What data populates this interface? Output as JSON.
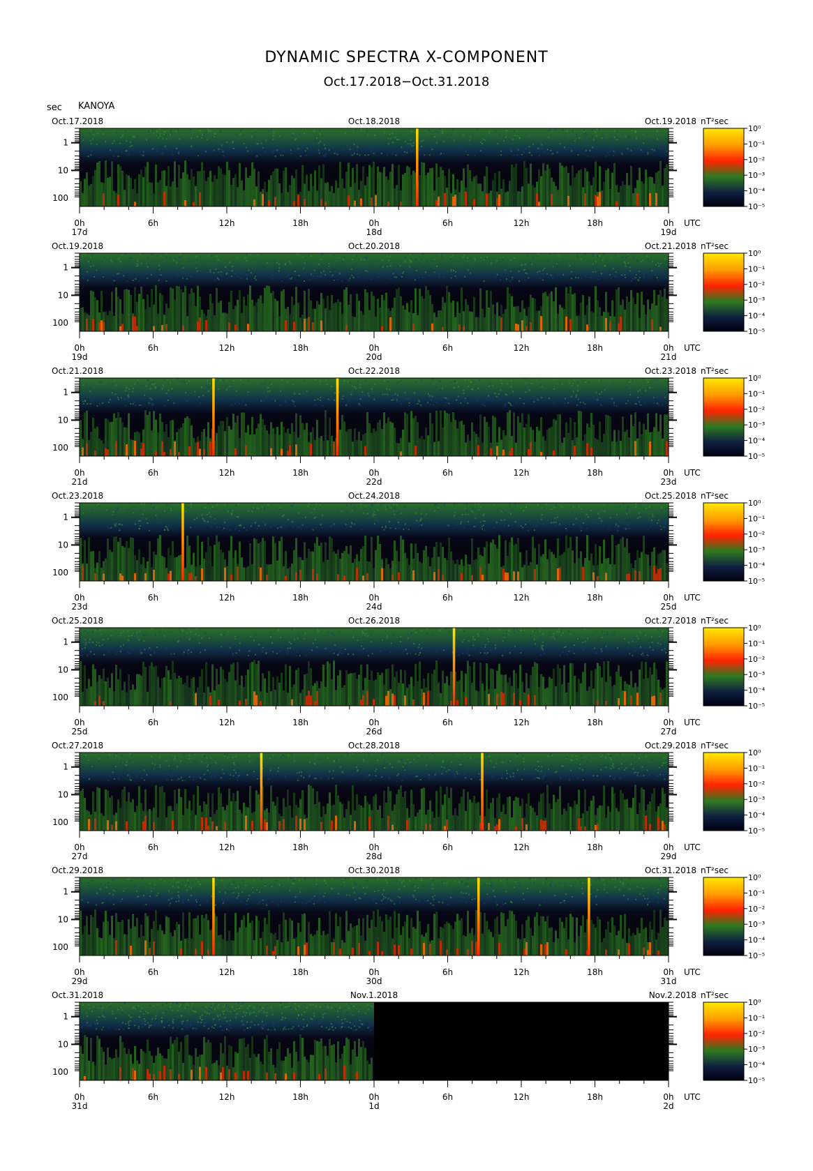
{
  "title": "DYNAMIC SPECTRA X-COMPONENT",
  "subtitle": "Oct.17.2018−Oct.31.2018",
  "axis_unit_label": "sec",
  "station": "KANOYA",
  "colorbar_unit": "nT²sec",
  "utc_label": "UTC",
  "y_tick_labels": [
    "1",
    "10",
    "100"
  ],
  "x_hour_labels": [
    "0h",
    "6h",
    "12h",
    "18h",
    "0h",
    "6h",
    "12h",
    "18h",
    "0h"
  ],
  "colorbar_ticks": [
    "10⁰",
    "10⁻¹",
    "10⁻²",
    "10⁻³",
    "10⁻⁴",
    "10⁻⁵"
  ],
  "colors": {
    "noise_low": "#0a0a28",
    "noise_band": "#2a6a28",
    "high_power": "#ff2a00",
    "peak": "#ffd800",
    "no_data": "#000000"
  },
  "panels": [
    {
      "date_left": "Oct.17.2018",
      "date_mid": "Oct.18.2018",
      "date_right": "Oct.19.2018",
      "day_left": "17d",
      "day_mid": "18d",
      "day_right": "19d",
      "spike_hours": [
        27.5
      ],
      "data_end_hours": 48
    },
    {
      "date_left": "Oct.19.2018",
      "date_mid": "Oct.20.2018",
      "date_right": "Oct.21.2018",
      "day_left": "19d",
      "day_mid": "20d",
      "day_right": "21d",
      "spike_hours": [],
      "data_end_hours": 48
    },
    {
      "date_left": "Oct.21.2018",
      "date_mid": "Oct.22.2018",
      "date_right": "Oct.23.2018",
      "day_left": "21d",
      "day_mid": "22d",
      "day_right": "23d",
      "spike_hours": [
        10.9,
        21
      ],
      "data_end_hours": 48
    },
    {
      "date_left": "Oct.23.2018",
      "date_mid": "Oct.24.2018",
      "date_right": "Oct.25.2018",
      "day_left": "23d",
      "day_mid": "24d",
      "day_right": "25d",
      "spike_hours": [
        8.4
      ],
      "data_end_hours": 48
    },
    {
      "date_left": "Oct.25.2018",
      "date_mid": "Oct.26.2018",
      "date_right": "Oct.27.2018",
      "day_left": "25d",
      "day_mid": "26d",
      "day_right": "27d",
      "spike_hours": [
        30.5
      ],
      "data_end_hours": 48
    },
    {
      "date_left": "Oct.27.2018",
      "date_mid": "Oct.28.2018",
      "date_right": "Oct.29.2018",
      "day_left": "27d",
      "day_mid": "28d",
      "day_right": "29d",
      "spike_hours": [
        14.8,
        32.8
      ],
      "data_end_hours": 48
    },
    {
      "date_left": "Oct.29.2018",
      "date_mid": "Oct.30.2018",
      "date_right": "Oct.31.2018",
      "day_left": "29d",
      "day_mid": "30d",
      "day_right": "31d",
      "spike_hours": [
        10.9,
        32.5,
        41.5
      ],
      "data_end_hours": 48
    },
    {
      "date_left": "Oct.31.2018",
      "date_mid": "Nov.1.2018",
      "date_right": "Nov.2.2018",
      "day_left": "31d",
      "day_mid": "1d",
      "day_right": "2d",
      "spike_hours": [],
      "data_end_hours": 24
    }
  ],
  "chart_data": {
    "type": "heatmap",
    "title": "DYNAMIC SPECTRA X-COMPONENT",
    "subtitle": "Oct.17.2018−Oct.31.2018",
    "xlabel": "UTC",
    "ylabel": "sec",
    "y_scale": "log",
    "ylim": [
      0.3,
      200
    ],
    "x_range_hours": [
      0,
      48
    ],
    "color_scale": "log",
    "color_range": [
      1e-05,
      1
    ],
    "colorbar_label": "nT²sec",
    "series": [
      {
        "period": "Oct.17.2018 - Oct.19.2018",
        "broadband_spikes_hours": [
          27.5
        ]
      },
      {
        "period": "Oct.19.2018 - Oct.21.2018",
        "broadband_spikes_hours": []
      },
      {
        "period": "Oct.21.2018 - Oct.23.2018",
        "broadband_spikes_hours": [
          10.9,
          21
        ]
      },
      {
        "period": "Oct.23.2018 - Oct.25.2018",
        "broadband_spikes_hours": [
          8.4
        ]
      },
      {
        "period": "Oct.25.2018 - Oct.27.2018",
        "broadband_spikes_hours": [
          30.5
        ]
      },
      {
        "period": "Oct.27.2018 - Oct.29.2018",
        "broadband_spikes_hours": [
          14.8,
          32.8
        ]
      },
      {
        "period": "Oct.29.2018 - Oct.31.2018",
        "broadband_spikes_hours": [
          10.9,
          32.5,
          41.5
        ]
      },
      {
        "period": "Oct.31.2018 - Nov.2.2018",
        "broadband_spikes_hours": [],
        "no_data_after_hours": 24
      }
    ]
  }
}
